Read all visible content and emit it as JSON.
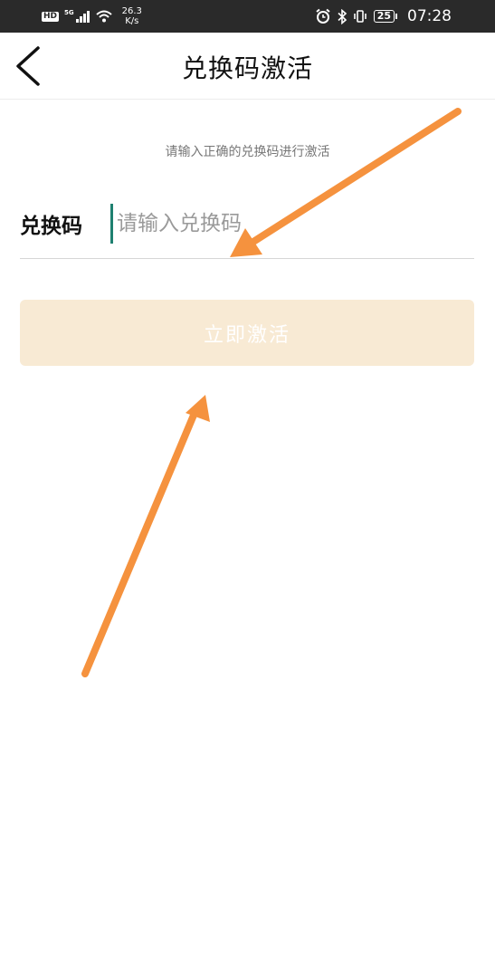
{
  "status_bar": {
    "hd": "HD",
    "network": "5G",
    "speed_value": "26.3",
    "speed_unit": "K/s",
    "battery": "25",
    "time": "07:28"
  },
  "nav": {
    "back_icon": "chevron-left-icon",
    "title": "兑换码激活"
  },
  "form": {
    "hint": "请输入正确的兑换码进行激活",
    "label": "兑换码",
    "placeholder": "请输入兑换码",
    "value": ""
  },
  "activate_button": {
    "label": "立即激活"
  },
  "colors": {
    "status_bg": "#2a2a2a",
    "button_bg": "#f8ead4",
    "cursor": "#1e8070",
    "annotation_arrow": "#f5923e"
  }
}
